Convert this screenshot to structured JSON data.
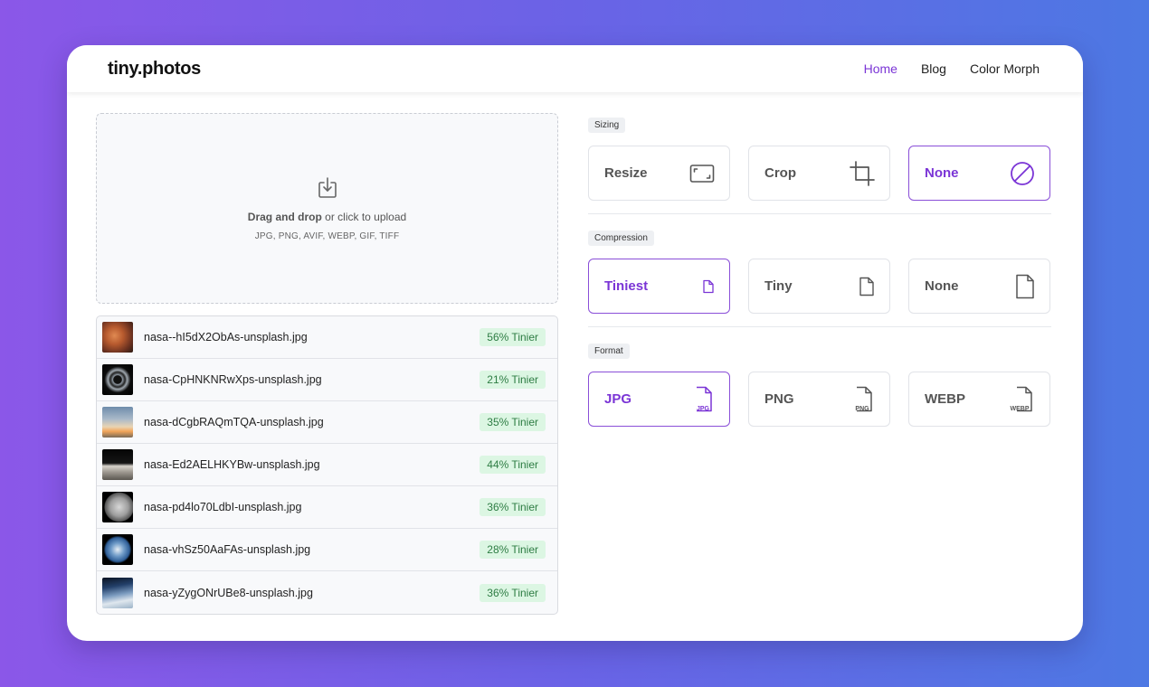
{
  "header": {
    "logo": "tiny.photos",
    "nav": [
      {
        "label": "Home",
        "active": true
      },
      {
        "label": "Blog",
        "active": false
      },
      {
        "label": "Color Morph",
        "active": false
      }
    ]
  },
  "dropzone": {
    "bold": "Drag and drop",
    "rest": " or click to upload",
    "formats": "JPG, PNG, AVIF, WEBP, GIF, TIFF",
    "icon": "download-tray-icon"
  },
  "files": [
    {
      "name": "nasa--hI5dX2ObAs-unsplash.jpg",
      "badge": "56% Tinier"
    },
    {
      "name": "nasa-CpHNKNRwXps-unsplash.jpg",
      "badge": "21% Tinier"
    },
    {
      "name": "nasa-dCgbRAQmTQA-unsplash.jpg",
      "badge": "35% Tinier"
    },
    {
      "name": "nasa-Ed2AELHKYBw-unsplash.jpg",
      "badge": "44% Tinier"
    },
    {
      "name": "nasa-pd4lo70LdbI-unsplash.jpg",
      "badge": "36% Tinier"
    },
    {
      "name": "nasa-vhSz50AaFAs-unsplash.jpg",
      "badge": "28% Tinier"
    },
    {
      "name": "nasa-yZygONrUBe8-unsplash.jpg",
      "badge": "36% Tinier"
    }
  ],
  "settings": {
    "sizing": {
      "label": "Sizing",
      "options": [
        {
          "label": "Resize",
          "icon": "resize-icon",
          "selected": false
        },
        {
          "label": "Crop",
          "icon": "crop-icon",
          "selected": false
        },
        {
          "label": "None",
          "icon": "none-circle-icon",
          "selected": true
        }
      ]
    },
    "compression": {
      "label": "Compression",
      "options": [
        {
          "label": "Tiniest",
          "icon": "file-small-icon",
          "selected": true
        },
        {
          "label": "Tiny",
          "icon": "file-medium-icon",
          "selected": false
        },
        {
          "label": "None",
          "icon": "file-large-icon",
          "selected": false
        }
      ]
    },
    "format": {
      "label": "Format",
      "options": [
        {
          "label": "JPG",
          "icon": "file-jpg-icon",
          "icon_text": "JPG",
          "selected": true
        },
        {
          "label": "PNG",
          "icon": "file-png-icon",
          "icon_text": "PNG",
          "selected": false
        },
        {
          "label": "WEBP",
          "icon": "file-webp-icon",
          "icon_text": "WEBP",
          "selected": false
        }
      ]
    }
  },
  "colors": {
    "accent": "#7b35d6",
    "badge_bg": "#dcf6e3",
    "badge_text": "#2e7d44"
  }
}
